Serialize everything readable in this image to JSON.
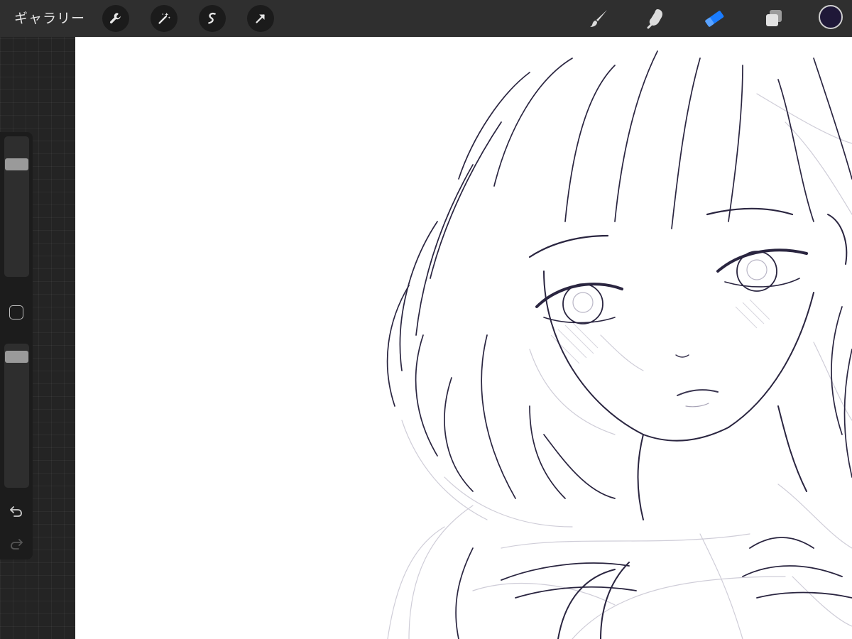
{
  "topbar": {
    "gallery_label": "ギャラリー",
    "actions": [
      {
        "name": "wrench-icon",
        "label": "actions"
      },
      {
        "name": "magic-wand-icon",
        "label": "adjustments"
      },
      {
        "name": "selection-icon",
        "label": "selection"
      },
      {
        "name": "transform-arrow-icon",
        "label": "transform"
      }
    ],
    "tools": [
      {
        "name": "brush-icon",
        "active": false
      },
      {
        "name": "smudge-icon",
        "active": false
      },
      {
        "name": "eraser-icon",
        "active": true
      },
      {
        "name": "layers-icon",
        "active": false
      }
    ],
    "current_color": "#1f1838",
    "active_tool_color": "#1a7cff"
  },
  "sidebar": {
    "brush_size_level": 0.83,
    "opacity_level": 0.95,
    "undo_icon": "undo-icon",
    "redo_icon": "redo-icon"
  },
  "colors": {
    "topbar_bg": "#2f2f2f",
    "canvas_bg": "#ffffff",
    "line_dark": "#2a2540",
    "line_light": "#c9c7d2"
  }
}
